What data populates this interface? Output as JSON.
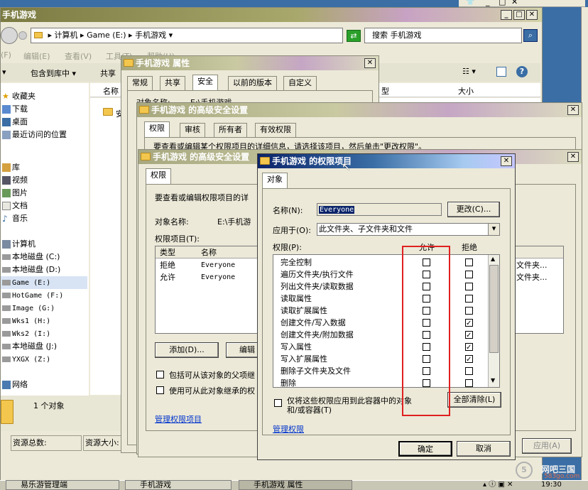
{
  "explorer": {
    "title": "手机游戏",
    "address_parts": [
      "计算机",
      "Game (E:)",
      "手机游戏"
    ],
    "search_placeholder": "搜索 手机游戏",
    "menu": [
      "(F)",
      "编辑(E)",
      "查看(V)",
      "工具(T)",
      "帮助(H)"
    ],
    "toolbar": [
      "包含到库中",
      "共享"
    ],
    "columns": {
      "name": "名称",
      "type": "型",
      "size": "大小"
    },
    "sidebar": {
      "favorites": "收藏夹",
      "fav_items": [
        "下载",
        "桌面",
        "最近访问的位置"
      ],
      "library": "库",
      "lib_items": [
        "视频",
        "图片",
        "文档",
        "音乐"
      ],
      "computer": "计算机",
      "drives": [
        "本地磁盘 (C:)",
        "本地磁盘 (D:)",
        "Game (E:)",
        "HotGame (F:)",
        "Image (G:)",
        "Wks1 (H:)",
        "Wks2 (I:)",
        "本地磁盘 (J:)",
        "YXGX (Z:)"
      ],
      "network": "网络"
    },
    "status": "1 个对象",
    "partial_item": "安"
  },
  "properties": {
    "title": "手机游戏 属性",
    "tabs": [
      "常规",
      "共享",
      "安全",
      "以前的版本",
      "自定义"
    ],
    "object_label": "对象名称:",
    "object_value": "E:\\手机游戏"
  },
  "adv1": {
    "title": "手机游戏 的高级安全设置",
    "tabs": [
      "权限",
      "审核",
      "所有者",
      "有效权限"
    ],
    "text": "要查看或编辑某个权限项目的详细信息，请选择该项目，然后单击\"更改权限\"。"
  },
  "adv2": {
    "title": "手机游戏 的高级安全设置",
    "tab": "权限",
    "desc": "要查看或编辑权限项目的详",
    "object_label": "对象名称:",
    "object_value": "E:\\手机游",
    "entries_label": "权限项目(T):",
    "columns": [
      "类型",
      "名称"
    ],
    "rows": [
      {
        "type": "拒绝",
        "name": "Everyone",
        "inherit": "文件夹..."
      },
      {
        "type": "允许",
        "name": "Everyone",
        "inherit": "文件夹..."
      }
    ],
    "add_btn": "添加(D)...",
    "edit_btn": "编辑",
    "cb1": "包括可从该对象的父项继",
    "cb2": "使用可从此对象继承的权",
    "manage_link": "管理权限项目",
    "apply_btn": "应用(A)"
  },
  "perm": {
    "title": "手机游戏 的权限项目",
    "tab": "对象",
    "name_label": "名称(N):",
    "name_value": "Everyone",
    "change_btn": "更改(C)...",
    "apply_label": "应用于(O):",
    "apply_value": "此文件夹、子文件夹和文件",
    "perm_label": "权限(P):",
    "allow_header": "允许",
    "deny_header": "拒绝",
    "permissions": [
      {
        "name": "完全控制",
        "allow": false,
        "deny": false
      },
      {
        "name": "遍历文件夹/执行文件",
        "allow": false,
        "deny": false
      },
      {
        "name": "列出文件夹/读取数据",
        "allow": false,
        "deny": false
      },
      {
        "name": "读取属性",
        "allow": false,
        "deny": false
      },
      {
        "name": "读取扩展属性",
        "allow": false,
        "deny": false
      },
      {
        "name": "创建文件/写入数据",
        "allow": false,
        "deny": true
      },
      {
        "name": "创建文件夹/附加数据",
        "allow": false,
        "deny": true
      },
      {
        "name": "写入属性",
        "allow": false,
        "deny": true
      },
      {
        "name": "写入扩展属性",
        "allow": false,
        "deny": true
      },
      {
        "name": "删除子文件夹及文件",
        "allow": false,
        "deny": false
      },
      {
        "name": "删除",
        "allow": false,
        "deny": false
      }
    ],
    "only_apply_line1": "仅将这些权限应用到此容器中的对象",
    "only_apply_line2": "和/或容器(T)",
    "clear_all_btn": "全部清除(L)",
    "manage_link": "管理权限",
    "ok_btn": "确定",
    "cancel_btn": "取消"
  },
  "status_bar": {
    "total_label": "资源总数:",
    "size_label": "资源大小:"
  },
  "taskbar": {
    "items": [
      "易乐游管理端",
      "手机游戏",
      "手机游戏 属性"
    ],
    "clock": "19:30"
  },
  "watermark": {
    "text": "网吧三国",
    "sub": "583go.com"
  },
  "colors": {
    "highlight_box": "#e02020",
    "link": "#0033cc"
  }
}
